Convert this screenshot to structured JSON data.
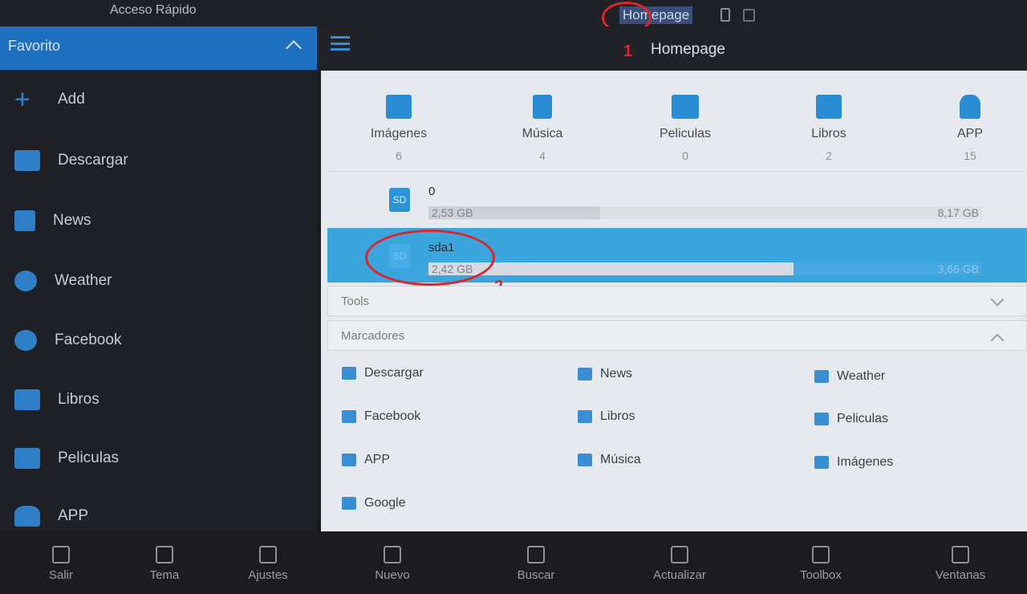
{
  "topbar": {
    "quick_access": "Acceso Rápido",
    "breadcrumb": "Homepage",
    "annotation_1": "1"
  },
  "sidebar": {
    "header": "Favorito",
    "items": [
      {
        "label": "Add",
        "icon": "plus-icon"
      },
      {
        "label": "Descargar",
        "icon": "download-folder-icon"
      },
      {
        "label": "News",
        "icon": "news-icon"
      },
      {
        "label": "Weather",
        "icon": "weather-icon"
      },
      {
        "label": "Facebook",
        "icon": "globe-icon"
      },
      {
        "label": "Libros",
        "icon": "book-icon"
      },
      {
        "label": "Peliculas",
        "icon": "movie-icon"
      },
      {
        "label": "APP",
        "icon": "android-icon"
      }
    ]
  },
  "header": {
    "title": "Homepage"
  },
  "categories": [
    {
      "label": "Imágenes",
      "count": "6",
      "icon": "image-icon"
    },
    {
      "label": "Música",
      "count": "4",
      "icon": "music-icon"
    },
    {
      "label": "Peliculas",
      "count": "0",
      "icon": "clapper-icon"
    },
    {
      "label": "Libros",
      "count": "2",
      "icon": "book-icon"
    },
    {
      "label": "APP",
      "count": "15",
      "icon": "android-icon"
    }
  ],
  "storage": [
    {
      "name": "0",
      "used": "2,53 GB",
      "total": "8,17 GB",
      "used_fraction": 0.31,
      "selected": false
    },
    {
      "name": "sda1",
      "used": "2,42 GB",
      "total": "3,66 GB",
      "used_fraction": 0.66,
      "selected": true,
      "annotation": "2"
    }
  ],
  "tools": {
    "label": "Tools"
  },
  "bookmarks": {
    "label": "Marcadores",
    "items": [
      "Descargar",
      "News",
      "Weather",
      "Facebook",
      "Libros",
      "Peliculas",
      "APP",
      "Música",
      "Imágenes",
      "Google"
    ]
  },
  "bottom": [
    {
      "label": "Salir",
      "icon": "exit-icon"
    },
    {
      "label": "Tema",
      "icon": "shirt-icon"
    },
    {
      "label": "Ajustes",
      "icon": "gear-icon"
    },
    {
      "label": "Nuevo",
      "icon": "plus-icon"
    },
    {
      "label": "Buscar",
      "icon": "search-icon"
    },
    {
      "label": "Actualizar",
      "icon": "refresh-icon"
    },
    {
      "label": "Toolbox",
      "icon": "tools-icon"
    },
    {
      "label": "Ventanas",
      "icon": "windows-icon"
    }
  ],
  "colors": {
    "accent": "#1f6fc0",
    "selected_row": "#3aa6dd",
    "annotation": "#e0242a"
  }
}
